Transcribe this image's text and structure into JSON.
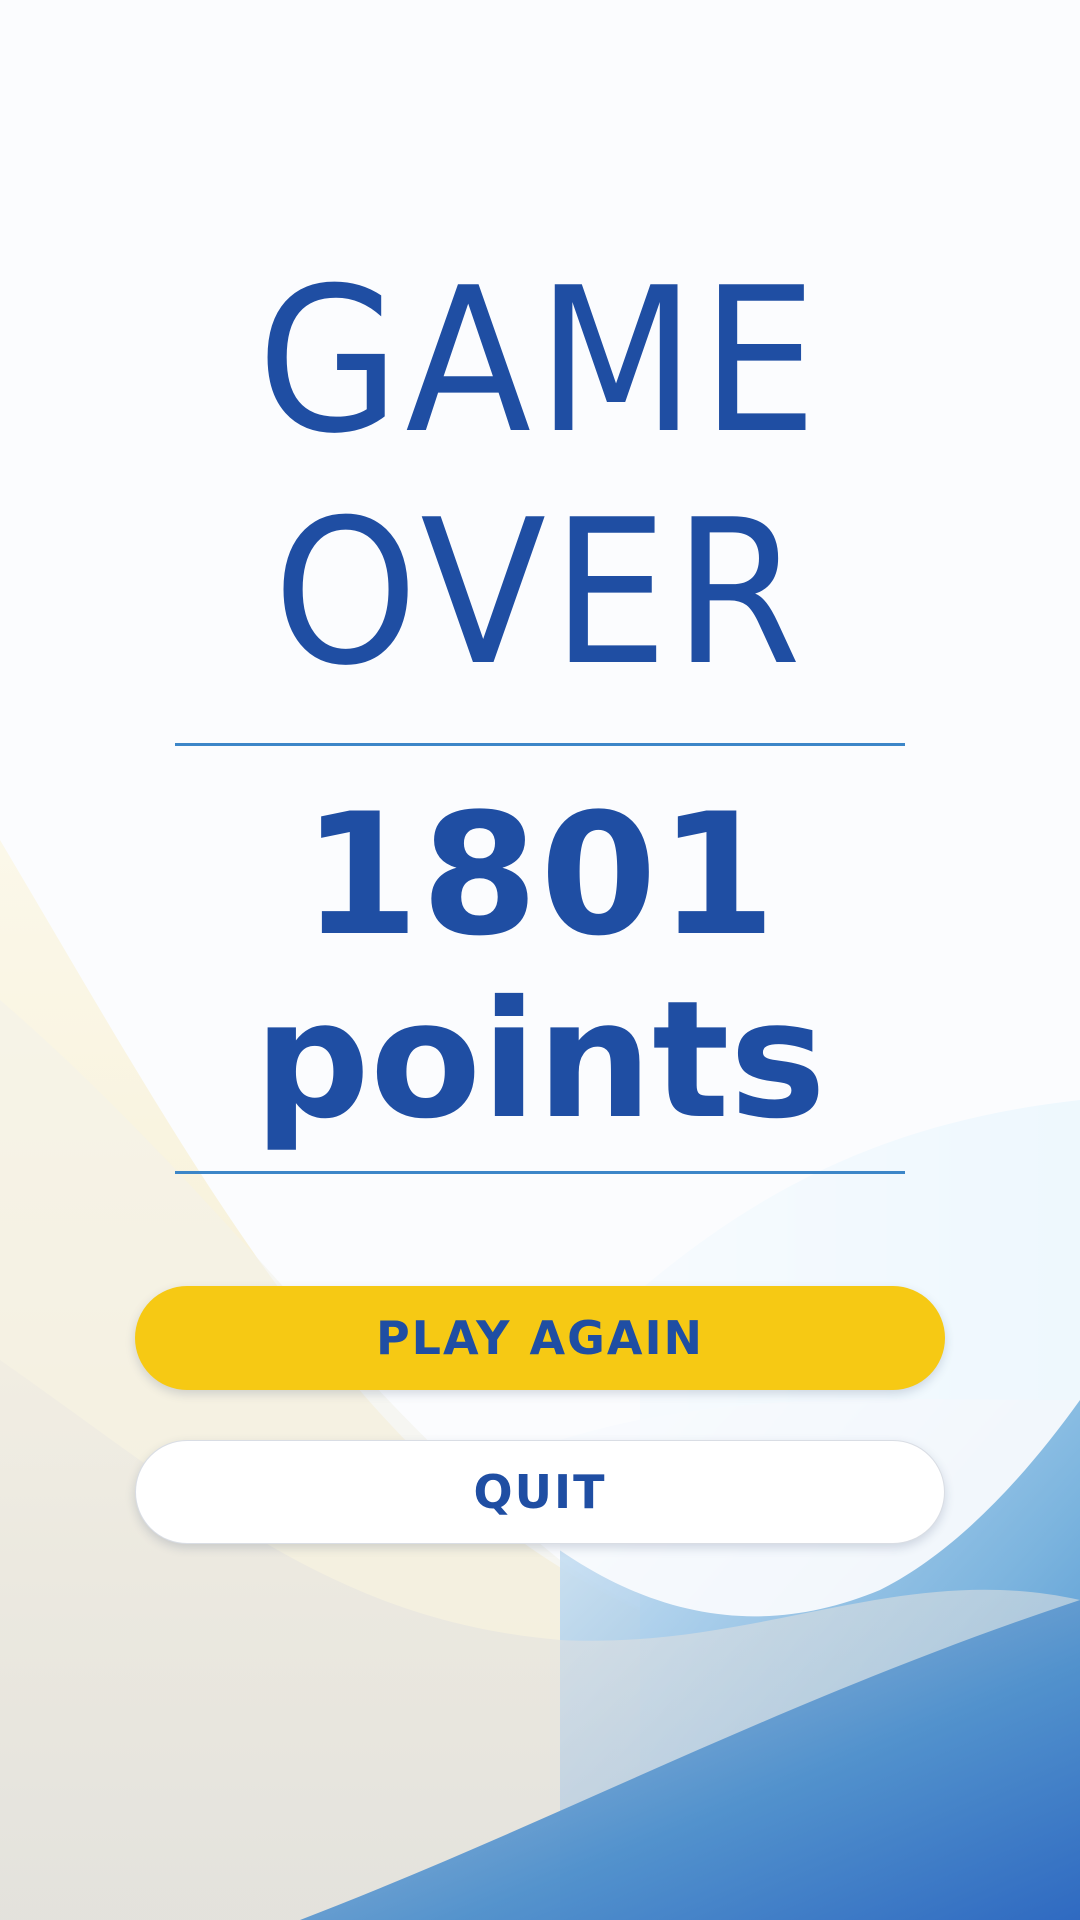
{
  "title": {
    "line1": "GAME",
    "line2": "OVER"
  },
  "score": {
    "value": "1801",
    "unit": "points"
  },
  "buttons": {
    "play_again": "PLAY AGAIN",
    "quit": "QUIT"
  },
  "colors": {
    "text": "#1f4ea3",
    "divider": "#3c86c8",
    "play_button": "#f6c914",
    "quit_button": "#ffffff"
  }
}
